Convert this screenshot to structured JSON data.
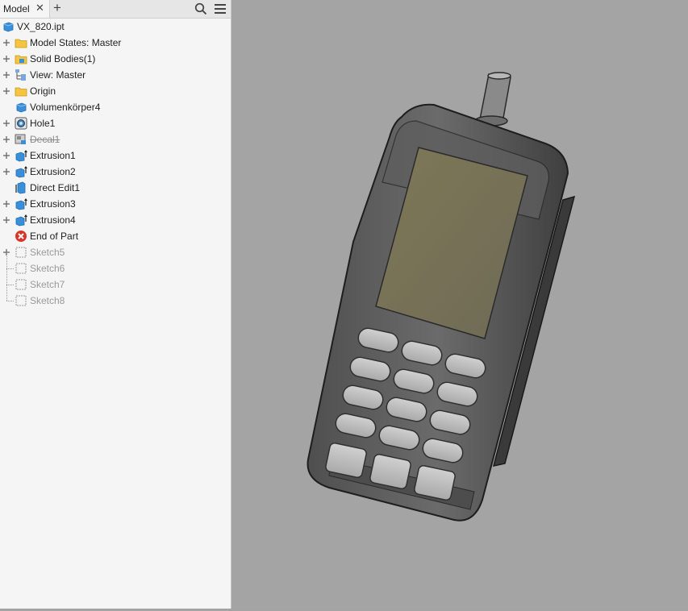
{
  "browser": {
    "tab_label": "Model",
    "tab_close_glyph": "✕",
    "add_tab_glyph": "+",
    "search_icon": "search-icon",
    "menu_icon": "hamburger-menu-icon"
  },
  "tree": {
    "root": {
      "label": "VX_820.ipt",
      "icon": "part-icon"
    },
    "items": [
      {
        "label": "Model States: Master",
        "icon": "folder-icon",
        "expandable": true,
        "state": "normal"
      },
      {
        "label": "Solid Bodies(1)",
        "icon": "solid-bodies-folder-icon",
        "expandable": true,
        "state": "normal"
      },
      {
        "label": "View: Master",
        "icon": "view-rep-icon",
        "expandable": true,
        "state": "normal"
      },
      {
        "label": "Origin",
        "icon": "folder-icon",
        "expandable": true,
        "state": "normal"
      },
      {
        "label": "Volumenkörper4",
        "icon": "solid-body-icon",
        "expandable": false,
        "state": "normal"
      },
      {
        "label": "Hole1",
        "icon": "hole-icon",
        "expandable": true,
        "state": "normal"
      },
      {
        "label": "Decal1",
        "icon": "decal-icon",
        "expandable": true,
        "state": "suppressed"
      },
      {
        "label": "Extrusion1",
        "icon": "extrusion-icon",
        "expandable": true,
        "state": "normal"
      },
      {
        "label": "Extrusion2",
        "icon": "extrusion-icon",
        "expandable": true,
        "state": "normal"
      },
      {
        "label": "Direct Edit1",
        "icon": "direct-edit-icon",
        "expandable": false,
        "state": "normal"
      },
      {
        "label": "Extrusion3",
        "icon": "extrusion-icon",
        "expandable": true,
        "state": "normal"
      },
      {
        "label": "Extrusion4",
        "icon": "extrusion-icon",
        "expandable": true,
        "state": "normal"
      },
      {
        "label": "End of Part",
        "icon": "end-of-part-icon",
        "expandable": false,
        "state": "normal"
      },
      {
        "label": "Sketch5",
        "icon": "sketch-icon",
        "expandable": true,
        "state": "below-eop"
      },
      {
        "label": "Sketch6",
        "icon": "sketch-icon",
        "expandable": false,
        "state": "below-eop"
      },
      {
        "label": "Sketch7",
        "icon": "sketch-icon",
        "expandable": false,
        "state": "below-eop"
      },
      {
        "label": "Sketch8",
        "icon": "sketch-icon",
        "expandable": false,
        "state": "below-eop"
      }
    ]
  },
  "viewport": {
    "background": "#a4a4a4",
    "model": "phone-handset-model"
  },
  "colors": {
    "panel_bg": "#f5f5f5",
    "icon_blue": "#3b8fd9",
    "folder_yellow": "#f5c542",
    "end_of_part_red": "#d8352a",
    "screen_olive": "#7d775a",
    "body_gray": "#5a5a5a"
  }
}
